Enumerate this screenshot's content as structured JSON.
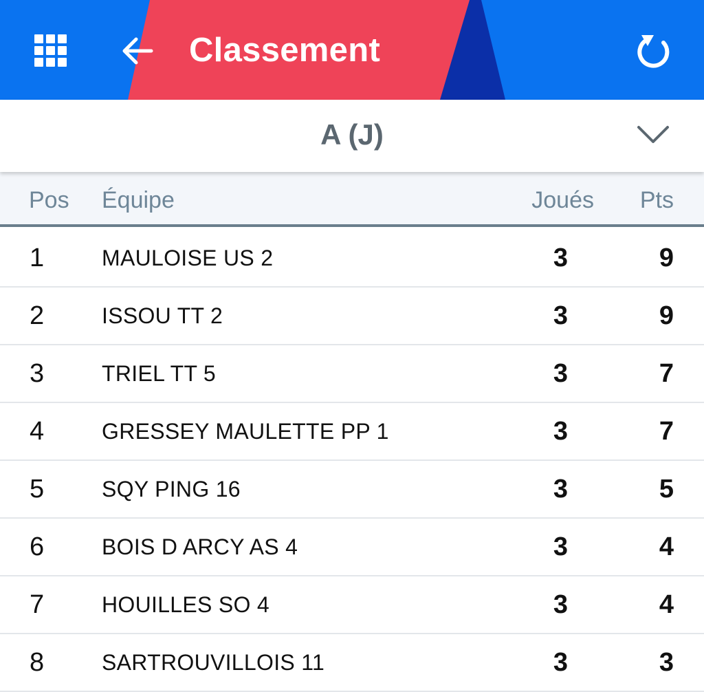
{
  "header": {
    "title": "Classement",
    "colors": {
      "bar": "#0a73f0",
      "accent_red": "#ef4358",
      "accent_navy": "#0b2fa8"
    },
    "icons": {
      "menu": "grid-menu-icon",
      "back": "arrow-left-icon",
      "refresh": "refresh-icon"
    }
  },
  "selector": {
    "value": "A (J)",
    "icon": "chevron-down-icon"
  },
  "table": {
    "columns": {
      "pos": "Pos",
      "team": "Équipe",
      "played": "Joués",
      "pts": "Pts"
    },
    "rows": [
      {
        "pos": "1",
        "team": "MAULOISE US 2",
        "played": "3",
        "pts": "9"
      },
      {
        "pos": "2",
        "team": "ISSOU TT 2",
        "played": "3",
        "pts": "9"
      },
      {
        "pos": "3",
        "team": "TRIEL TT 5",
        "played": "3",
        "pts": "7"
      },
      {
        "pos": "4",
        "team": "GRESSEY MAULETTE PP 1",
        "played": "3",
        "pts": "7"
      },
      {
        "pos": "5",
        "team": "SQY PING 16",
        "played": "3",
        "pts": "5"
      },
      {
        "pos": "6",
        "team": "BOIS D ARCY AS 4",
        "played": "3",
        "pts": "4"
      },
      {
        "pos": "7",
        "team": "HOUILLES SO 4",
        "played": "3",
        "pts": "4"
      },
      {
        "pos": "8",
        "team": "SARTROUVILLOIS 11",
        "played": "3",
        "pts": "3"
      }
    ]
  }
}
